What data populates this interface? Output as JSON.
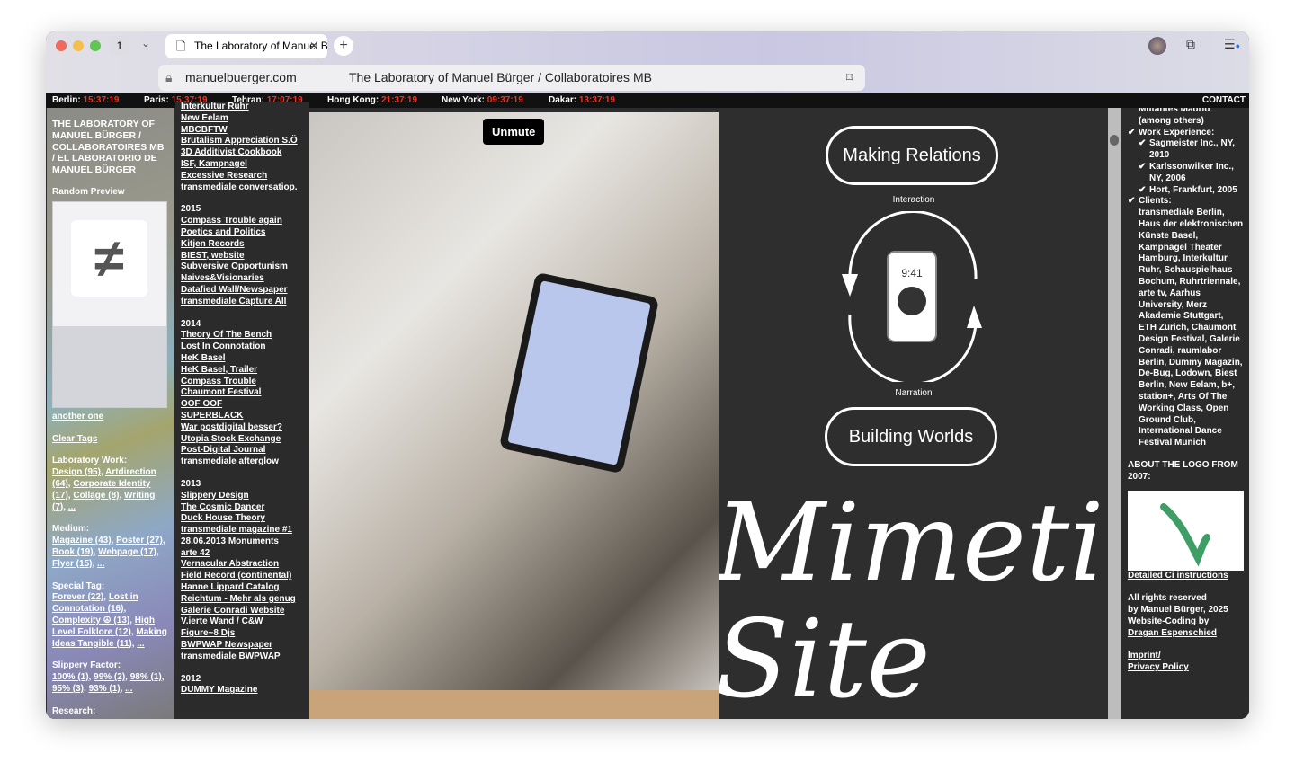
{
  "browser": {
    "tab_count": "1",
    "tab_title": "The Laboratory of Manuel Bürger / Collaboratoires MB",
    "url": "manuelbuerger.com",
    "page_title": "The Laboratory of Manuel Bürger / Collaboratoires MB"
  },
  "clocks": [
    {
      "city": "Berlin:",
      "time": "15:37:19"
    },
    {
      "city": "Paris:",
      "time": "15:37:19"
    },
    {
      "city": "Tehran:",
      "time": "17:07:19"
    },
    {
      "city": "Hong Kong:",
      "time": "21:37:19"
    },
    {
      "city": "New York:",
      "time": "09:37:19"
    },
    {
      "city": "Dakar:",
      "time": "13:37:19"
    }
  ],
  "contact": "CONTACT",
  "left": {
    "title": "THE LABORATORY OF MANUEL BÜRGER / COLLABORATOIRES MB / EL LABORATORIO DE MANUEL BÜRGER",
    "random_preview": "Random Preview",
    "another_one": "another one",
    "clear_tags": "Clear Tags",
    "lab_work": {
      "label": "Laboratory Work:",
      "items": [
        "Design (95)",
        "Artdirection (64)",
        "Corporate Identity (17)",
        "Collage (8)",
        "Writing (7)",
        "..."
      ]
    },
    "medium": {
      "label": "Medium:",
      "items": [
        "Magazine (43)",
        "Poster (27)",
        "Book (19)",
        "Webpage (17)",
        "Flyer (15)",
        "..."
      ]
    },
    "special": {
      "label": "Special Tag:",
      "items": [
        "Forever (22)",
        "Lost in Connotation (16)",
        "Complexity ☮ (13)",
        "High Level Folklore (12)",
        "Making Ideas Tangible (11)",
        "..."
      ]
    },
    "slippery": {
      "label": "Slippery Factor:",
      "items": [
        "100% (1)",
        "99% (2)",
        "98% (1)",
        "95% (3)",
        "93% (1)",
        "..."
      ]
    },
    "research": "Research:"
  },
  "projects": [
    {
      "year": "",
      "items": [
        "Interkultur Ruhr",
        "New Eelam",
        "MBCBFTW",
        "Brutalism Appreciation S.Ö",
        "3D Additivist Cookbook",
        "ISF, Kampnagel",
        "Excessive Research",
        "transmediale conversatiop."
      ]
    },
    {
      "year": "2015",
      "items": [
        "Compass Trouble again",
        "Poetics and Politics",
        "Kitjen Records",
        "BIEST, website",
        "Subversive Opportunism",
        "Naives&Visionaries",
        "Datafied Wall/Newspaper",
        "transmediale Capture All"
      ]
    },
    {
      "year": "2014",
      "items": [
        "Theory Of The Bench",
        "Lost In Connotation",
        "HeK Basel",
        "HeK Basel, Trailer",
        "Compass Trouble",
        "Chaumont Festival",
        "OOF OOF",
        "SUPERBLACK",
        "War postdigital besser?",
        "Utopia Stock Exchange",
        "Post-Digital Journal",
        "transmediale afterglow"
      ]
    },
    {
      "year": "2013",
      "items": [
        "Slippery Design",
        "The Cosmic Dancer",
        "Duck House Theory",
        "transmediale magazine #1",
        "28.06.2013 Monuments",
        "arte 42",
        "Vernacular Abstraction",
        "Field Record (continental)",
        "Hanne Lippard Catalog",
        "Reichtum - Mehr als genug",
        "Galerie Conradi Website",
        "V.ierte Wand / C&W",
        "Figure~8 Djs",
        "BWPWAP Newspaper",
        "transmediale BWPWAP"
      ]
    },
    {
      "year": "2012",
      "items": [
        "DUMMY Magazine"
      ]
    }
  ],
  "video": {
    "unmute": "Unmute"
  },
  "graphic": {
    "top": "Making Relations",
    "interaction": "Interaction",
    "phone_time": "9:41",
    "narration": "Narration",
    "bottom": "Building Worlds",
    "script": "Mimetic Site"
  },
  "right": {
    "top_text": "Mutantes Madrid (among others)",
    "work_label": "Work Experience:",
    "work": [
      "Sagmeister Inc., NY, 2010",
      "Karlssonwilker Inc., NY, 2006",
      "Hort, Frankfurt, 2005"
    ],
    "clients_label": "Clients:",
    "clients": "transmediale Berlin, Haus der elektronischen Künste Basel, Kampnagel Theater Hamburg, Interkultur Ruhr, Schauspielhaus Bochum, Ruhrtriennale, arte tv, Aarhus University, Merz Akademie Stuttgart, ETH Zürich, Chaumont Design Festival, Galerie Conradi, raumlabor Berlin, Dummy Magazin, De-Bug, Lodown, Biest Berlin, New Eelam, b+, station+, Arts Of The Working Class, Open Ground Club, International Dance Festival Munich",
    "logo_heading": "ABOUT THE LOGO FROM 2007:",
    "ci_link": "Detailed Ci instructions",
    "rights1": "All rights reserved",
    "rights2": "by Manuel Bürger, 2025",
    "coding": "Website-Coding by",
    "coder": "Dragan Espenschied",
    "imprint": "Imprint/",
    "privacy": "Privacy Policy"
  },
  "colors": {
    "clock_time": "#ee3322",
    "logo_green": "#3f9e66"
  }
}
